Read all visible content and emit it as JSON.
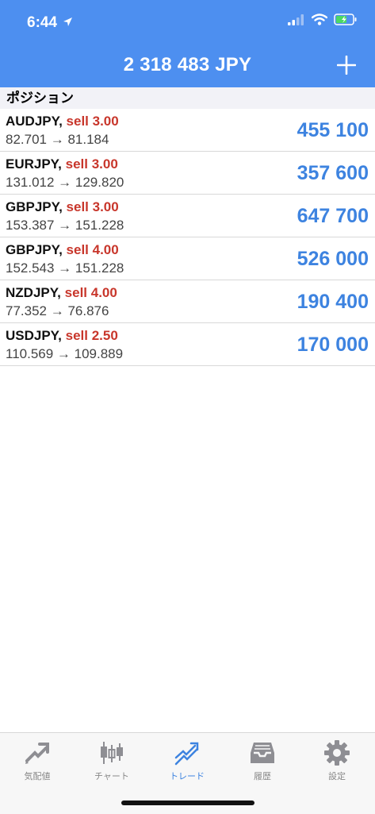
{
  "status": {
    "time": "6:44"
  },
  "header": {
    "title": "2 318 483 JPY"
  },
  "section": {
    "title": "ポジション"
  },
  "positions": [
    {
      "symbol": "AUDJPY,",
      "side": "sell 3.00",
      "prices": "82.701 → 81.184",
      "profit": "455 100"
    },
    {
      "symbol": "EURJPY,",
      "side": "sell 3.00",
      "prices": "131.012 → 129.820",
      "profit": "357 600"
    },
    {
      "symbol": "GBPJPY,",
      "side": "sell 3.00",
      "prices": "153.387 → 151.228",
      "profit": "647 700"
    },
    {
      "symbol": "GBPJPY,",
      "side": "sell 4.00",
      "prices": "152.543 → 151.228",
      "profit": "526 000"
    },
    {
      "symbol": "NZDJPY,",
      "side": "sell 4.00",
      "prices": "77.352 → 76.876",
      "profit": "190 400"
    },
    {
      "symbol": "USDJPY,",
      "side": "sell 2.50",
      "prices": "110.569 → 109.889",
      "profit": "170 000"
    }
  ],
  "tabs": [
    {
      "label": "気配値",
      "icon": "quotes-icon"
    },
    {
      "label": "チャート",
      "icon": "candlestick-chart-icon"
    },
    {
      "label": "トレード",
      "icon": "trade-icon",
      "active": true
    },
    {
      "label": "履歴",
      "icon": "history-tray-icon"
    },
    {
      "label": "設定",
      "icon": "gear-icon"
    }
  ],
  "colors": {
    "header": "#4d8ff0",
    "sell": "#c8362b",
    "profit": "#3d83e0",
    "tab_active": "#3d83e0",
    "tab_inactive": "#888888"
  }
}
